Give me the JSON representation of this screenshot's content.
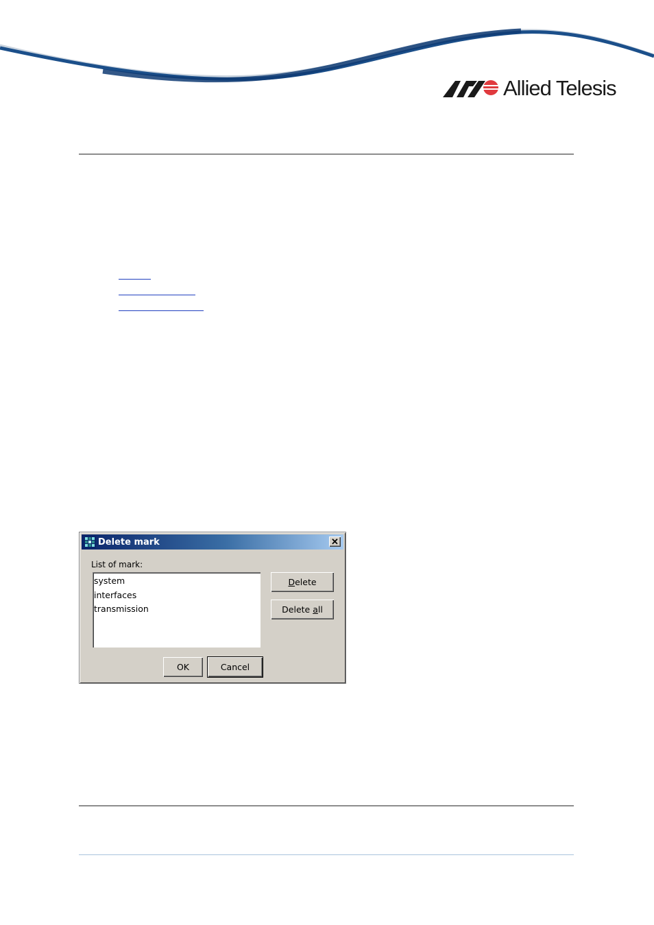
{
  "brand": {
    "logo_text": "Allied Telesis",
    "colors": {
      "swoosh": "#1b4f8a",
      "logo_red": "#e03a3e",
      "logo_black": "#1a1a1a"
    }
  },
  "dialog": {
    "title": "Delete mark",
    "close_label": "✕",
    "list_label": "List of mark:",
    "list_items": [
      "system",
      "interfaces",
      "transmission"
    ],
    "buttons": {
      "delete": {
        "pre": "",
        "accel": "D",
        "post": "elete"
      },
      "delete_all": {
        "pre": "Delete ",
        "accel": "a",
        "post": "ll"
      },
      "ok": "OK",
      "cancel": "Cancel"
    }
  }
}
